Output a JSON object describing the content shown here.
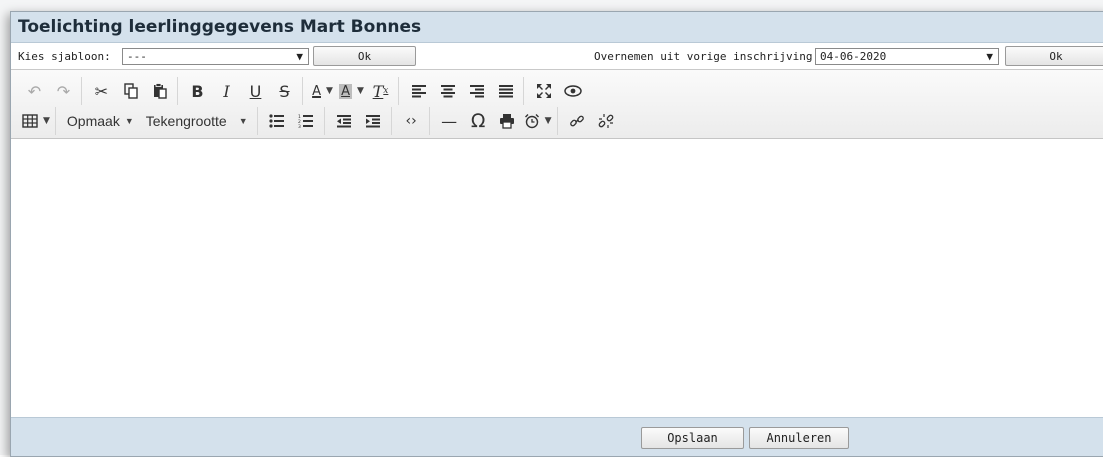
{
  "dialog": {
    "title": "Toelichting leerlinggegevens Mart Bonnes",
    "template_label": "Kies sjabloon:",
    "template_value": "---",
    "template_ok": "Ok",
    "copy_label": "Overnemen uit vorige inschrijving:",
    "copy_value": "04-06-2020",
    "copy_ok": "Ok"
  },
  "toolbar": {
    "format_label": "Opmaak",
    "fontsize_label": "Tekengrootte"
  },
  "footer": {
    "save_label": "Opslaan",
    "cancel_label": "Annuleren"
  },
  "colors": {
    "header_bg": "#d4e1ec",
    "footer_bg": "#d4e1ec"
  }
}
